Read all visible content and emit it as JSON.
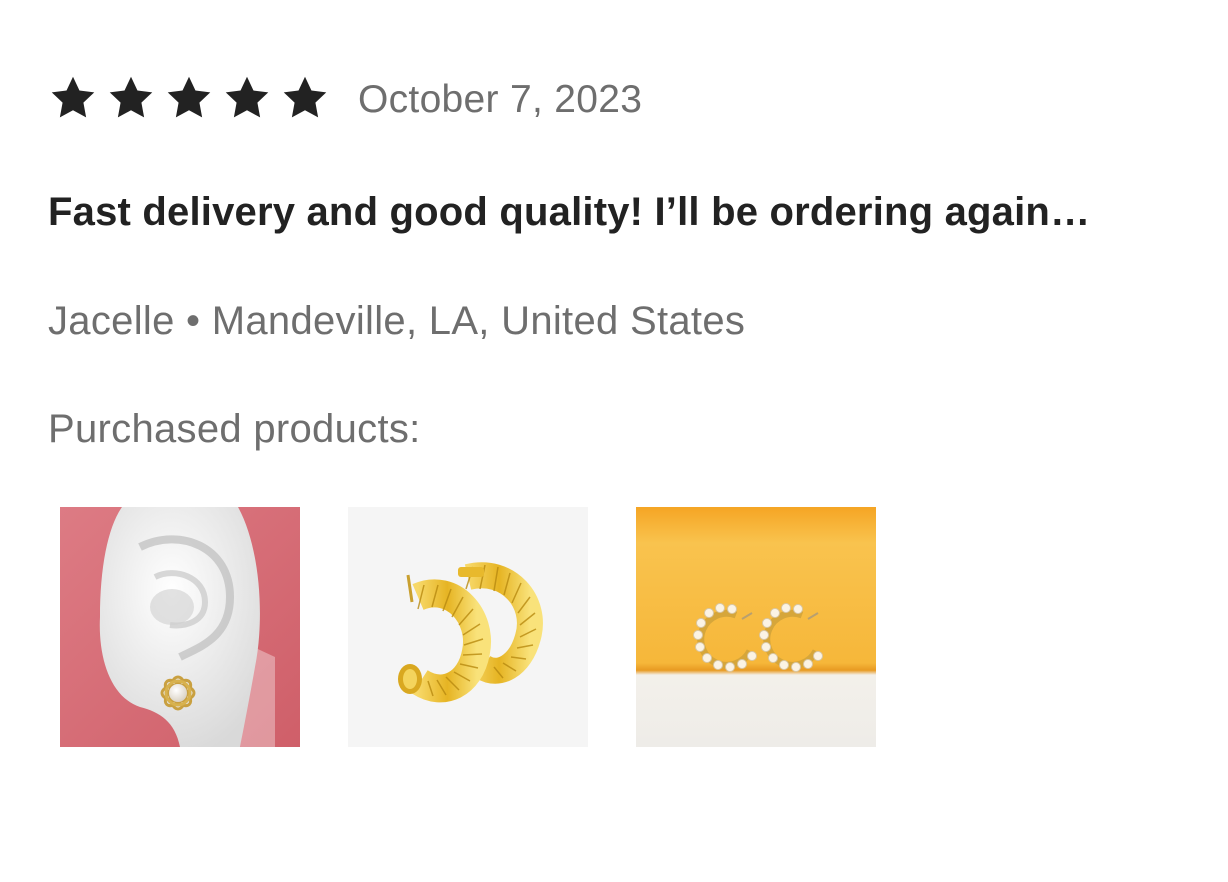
{
  "review": {
    "rating": 5,
    "rating_max": 5,
    "star_color": "#222222",
    "star_icon": "star-filled-icon",
    "date": "October 7, 2023",
    "text": "Fast delivery and good quality! I’ll be ordering again…",
    "reviewer": "Jacelle • Mandeville, LA, United States"
  },
  "purchased": {
    "label": "Purchased products:",
    "products": [
      {
        "thumbnail": "gold-flower-pearl-stud-earring-on-ear-model",
        "background": "#d9707a"
      },
      {
        "thumbnail": "gold-coil-hoop-earrings",
        "background": "#f5f5f5"
      },
      {
        "thumbnail": "gold-pearl-c-hoop-earrings-on-yellow",
        "background": "#f4a934"
      }
    ]
  }
}
